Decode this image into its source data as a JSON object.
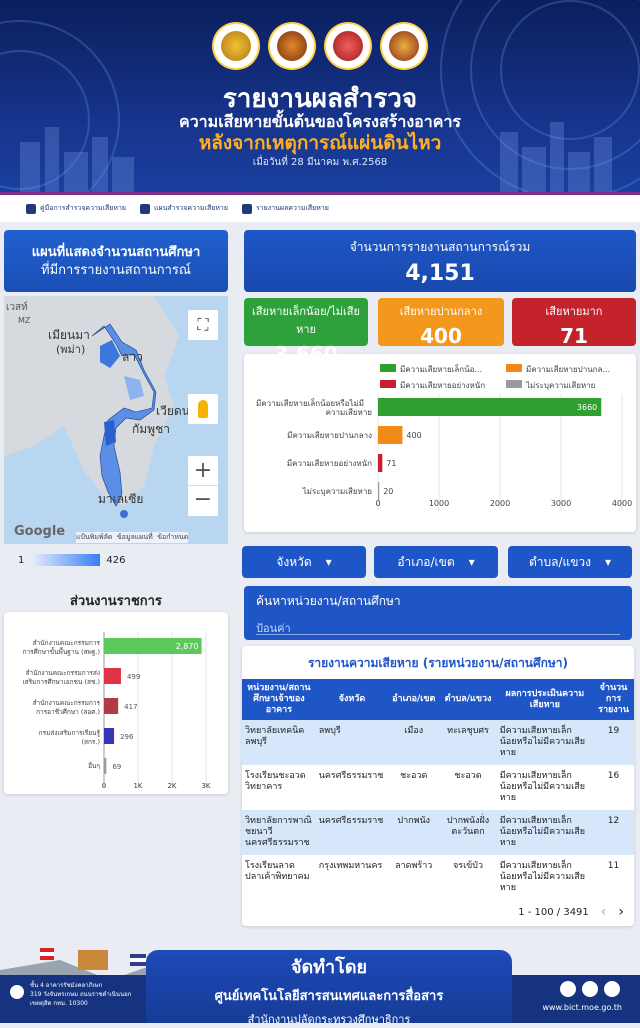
{
  "header": {
    "title": "รายงานผลสำรวจ",
    "subtitle1": "ความเสียหายขั้นต้นของโครงสร้างอาคาร",
    "subtitle2": "หลังจากเหตุการณ์แผ่นดินไหว",
    "date": "เมื่อวันที่ 28 มีนาคม พ.ศ.2568"
  },
  "nav": {
    "items": [
      {
        "label": "คู่มือการสำรวจความเสียหาย",
        "icon": "manual-icon"
      },
      {
        "label": "แผนสำรวจความเสียหาย",
        "icon": "plan-icon"
      },
      {
        "label": "รายงานผลความเสียหาย",
        "icon": "report-icon"
      }
    ]
  },
  "map_panel": {
    "title1": "แผนที่แสดงจำนวนสถานศึกษา",
    "title2": "ที่มีการรายงานสถานการณ์",
    "labels": {
      "myanmar": "เมียนมา",
      "myanmar2": "(พม่า)",
      "laos": "ลาว",
      "vietnam": "เวียดนาม",
      "cambodia": "กัมพูชา",
      "malaysia": "มาเลเซีย",
      "google": "Google",
      "india": "เวสท์",
      "shortcuts": "แป้นพิมพ์ลัด",
      "mapdata": "ข้อมูลแผนที่",
      "terms": "ข้อกำหนด",
      "mz": "MZ"
    },
    "scale_min": "1",
    "scale_max": "426"
  },
  "gov_section": {
    "title": "ส่วนงานราชการ"
  },
  "gov_chart": {
    "type": "bar",
    "categories": [
      "สำนักงานคณะกรรมการการศึกษาขั้นพื้นฐาน (สพฐ.)",
      "สำนักงานคณะกรรมการส่งเสริมการศึกษาเอกชน (สช.)",
      "สำนักงานคณะกรรมการการอาชีวศึกษา (สอศ.)",
      "กรมส่งเสริมการเรียนรู้ (สกร.)",
      "อื่นๆ"
    ],
    "values": [
      2870,
      499,
      417,
      296,
      69
    ],
    "value_labels": [
      "2,870",
      "499",
      "417",
      "296",
      "69"
    ],
    "colors": [
      "#5dc95d",
      "#e0334a",
      "#b03a46",
      "#3c34b8",
      "#9a9a9a"
    ],
    "xticks": [
      "0",
      "1K",
      "2K",
      "3K"
    ],
    "xlim": [
      0,
      3000
    ]
  },
  "kpis": {
    "total_label": "จำนวนการรายงานสถานการณ์รวม",
    "total_value": "4,151",
    "low_label": "เสียหายเล็กน้อย/ไม่เสียหาย",
    "low_value": "3,660",
    "mid_label": "เสียหายปานกลาง",
    "mid_value": "400",
    "high_label": "เสียหายมาก",
    "high_value": "71"
  },
  "chart_data": {
    "type": "bar",
    "orientation": "horizontal",
    "categories": [
      "มีความเสียหายเล็กน้อยหรือไม่มีความเสียหาย",
      "มีความเสียหายปานกลาง",
      "มีความเสียหายอย่างหนัก",
      "ไม่ระบุความเสียหาย"
    ],
    "values": [
      3660,
      400,
      71,
      20
    ],
    "colors": [
      "#2fa02f",
      "#f28a18",
      "#c8202e",
      "#9b9b9b"
    ],
    "legend": [
      "มีความเสียหายเล็กน้อ...",
      "มีความเสียหายปานกล...",
      "มีความเสียหายอย่างหนัก",
      "ไม่ระบุความเสียหาย"
    ],
    "xticks": [
      "0",
      "1000",
      "2000",
      "3000",
      "4000"
    ],
    "xlim": [
      0,
      4000
    ]
  },
  "filters": {
    "province": "จังหวัด",
    "district": "อำเภอ/เขต",
    "subdistrict": "ตำบล/แขวง"
  },
  "search": {
    "label": "ค้นหาหน่วยงาน/สถานศึกษา",
    "placeholder": "ป้อนค่า"
  },
  "table": {
    "title": "รายงานความเสียหาย (รายหน่วยงาน/สถานศึกษา)",
    "headers": [
      "หน่วยงาน/สถานศึกษาเจ้าของอาคาร",
      "จังหวัด",
      "อำเภอ/เขต",
      "ตำบล/แขวง",
      "ผลการประเมินความเสียหาย",
      "จำนวนการรายงาน"
    ],
    "rows": [
      [
        "วิทยาลัยเทคนิคลพบุรี",
        "ลพบุรี",
        "เมือง",
        "ทะเลชุบศร",
        "มีความเสียหายเล็กน้อยหรือไม่มีความเสียหาย",
        "19"
      ],
      [
        "โรงเรียนชะอวดวิทยาคาร",
        "นครศรีธรรมราช",
        "ชะอวด",
        "ชะอวด",
        "มีความเสียหายเล็กน้อยหรือไม่มีความเสียหาย",
        "16"
      ],
      [
        "วิทยาลัยการพาณิชยนาวีนครศรีธรรมราช",
        "นครศรีธรรมราช",
        "ปากพนัง",
        "ปากพนังฝั่งตะวันตก",
        "มีความเสียหายเล็กน้อยหรือไม่มีความเสียหาย",
        "12"
      ],
      [
        "โรงเรียนลาดปลาเค้าพิทยาคม",
        "กรุงเทพมหานคร",
        "ลาดพร้าว",
        "จรเข้บัว",
        "มีความเสียหายเล็กน้อยหรือไม่มีความเสียหาย",
        "11"
      ]
    ],
    "pagination": "1 - 100 / 3491"
  },
  "footer": {
    "org_by": "จัดทำโดย",
    "org_name": "ศูนย์เทคโนโลยีสารสนเทศและการสื่อสาร",
    "org_sub": "สำนักงานปลัดกระทรวงศึกษาธิการ",
    "address1": "ชั้น 4 อาคารรัชมังคลาภิเษก",
    "address2": "319 วังจันทรเกษม ถนนราชดำเนินนอก",
    "address3": "เขตดุสิต กทม. 10300",
    "website": "www.bict.moe.go.th"
  }
}
